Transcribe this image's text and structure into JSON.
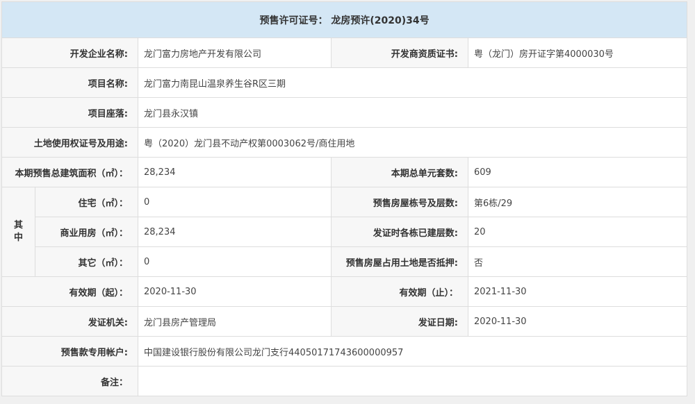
{
  "title": "预售许可证号： 龙房预许(2020)34号",
  "rows": {
    "developer": {
      "label": "开发企业名称:",
      "value": "龙门富力房地产开发有限公司"
    },
    "qualification": {
      "label": "开发商资质证书:",
      "value": "粤（龙门）房开证字第4000030号"
    },
    "project_name": {
      "label": "项目名称:",
      "value": "龙门富力南昆山温泉养生谷R区三期"
    },
    "location": {
      "label": "项目座落:",
      "value": "龙门县永汉镇"
    },
    "land_cert": {
      "label": "土地使用权证号及用途:",
      "value": "粤（2020）龙门县不动产权第0003062号/商住用地"
    },
    "total_area": {
      "label": "本期预售总建筑面积（㎡）：",
      "value": "28,234"
    },
    "total_units": {
      "label": "本期总单元套数:",
      "value": "609"
    },
    "qizhong": {
      "char1": "其",
      "char2": "中"
    },
    "residential": {
      "label": "住宅（㎡）：",
      "value": "0"
    },
    "building_floors": {
      "label": "预售房屋栋号及层数:",
      "value": "第6栋/29"
    },
    "commercial": {
      "label": "商业用房（㎡）：",
      "value": "28,234"
    },
    "built_floors": {
      "label": "发证时各栋已建层数:",
      "value": "20"
    },
    "other": {
      "label": "其它（㎡）：",
      "value": "0"
    },
    "mortgage": {
      "label": "预售房屋占用土地是否抵押:",
      "value": "否"
    },
    "valid_from": {
      "label": "有效期（起）：",
      "value": "2020-11-30"
    },
    "valid_to": {
      "label": "有效期（止）：",
      "value": "2021-11-30"
    },
    "issuer": {
      "label": "发证机关:",
      "value": "龙门县房产管理局"
    },
    "issue_date": {
      "label": "发证日期:",
      "value": "2020-11-30"
    },
    "account": {
      "label": "预售款专用帐户:",
      "value": "中国建设银行股份有限公司龙门支行44050171743600000957"
    },
    "remarks": {
      "label": "备注：",
      "value": ""
    }
  }
}
